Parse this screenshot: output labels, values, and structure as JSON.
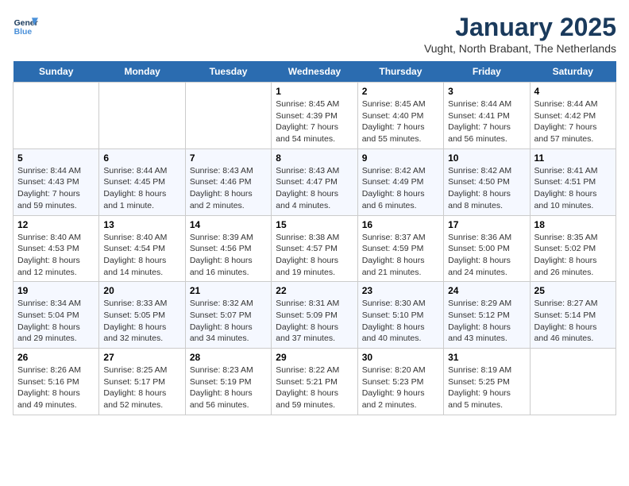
{
  "header": {
    "logo_line1": "General",
    "logo_line2": "Blue",
    "month_title": "January 2025",
    "subtitle": "Vught, North Brabant, The Netherlands"
  },
  "weekdays": [
    "Sunday",
    "Monday",
    "Tuesday",
    "Wednesday",
    "Thursday",
    "Friday",
    "Saturday"
  ],
  "weeks": [
    [
      {
        "day": "",
        "info": ""
      },
      {
        "day": "",
        "info": ""
      },
      {
        "day": "",
        "info": ""
      },
      {
        "day": "1",
        "info": "Sunrise: 8:45 AM\nSunset: 4:39 PM\nDaylight: 7 hours\nand 54 minutes."
      },
      {
        "day": "2",
        "info": "Sunrise: 8:45 AM\nSunset: 4:40 PM\nDaylight: 7 hours\nand 55 minutes."
      },
      {
        "day": "3",
        "info": "Sunrise: 8:44 AM\nSunset: 4:41 PM\nDaylight: 7 hours\nand 56 minutes."
      },
      {
        "day": "4",
        "info": "Sunrise: 8:44 AM\nSunset: 4:42 PM\nDaylight: 7 hours\nand 57 minutes."
      }
    ],
    [
      {
        "day": "5",
        "info": "Sunrise: 8:44 AM\nSunset: 4:43 PM\nDaylight: 7 hours\nand 59 minutes."
      },
      {
        "day": "6",
        "info": "Sunrise: 8:44 AM\nSunset: 4:45 PM\nDaylight: 8 hours\nand 1 minute."
      },
      {
        "day": "7",
        "info": "Sunrise: 8:43 AM\nSunset: 4:46 PM\nDaylight: 8 hours\nand 2 minutes."
      },
      {
        "day": "8",
        "info": "Sunrise: 8:43 AM\nSunset: 4:47 PM\nDaylight: 8 hours\nand 4 minutes."
      },
      {
        "day": "9",
        "info": "Sunrise: 8:42 AM\nSunset: 4:49 PM\nDaylight: 8 hours\nand 6 minutes."
      },
      {
        "day": "10",
        "info": "Sunrise: 8:42 AM\nSunset: 4:50 PM\nDaylight: 8 hours\nand 8 minutes."
      },
      {
        "day": "11",
        "info": "Sunrise: 8:41 AM\nSunset: 4:51 PM\nDaylight: 8 hours\nand 10 minutes."
      }
    ],
    [
      {
        "day": "12",
        "info": "Sunrise: 8:40 AM\nSunset: 4:53 PM\nDaylight: 8 hours\nand 12 minutes."
      },
      {
        "day": "13",
        "info": "Sunrise: 8:40 AM\nSunset: 4:54 PM\nDaylight: 8 hours\nand 14 minutes."
      },
      {
        "day": "14",
        "info": "Sunrise: 8:39 AM\nSunset: 4:56 PM\nDaylight: 8 hours\nand 16 minutes."
      },
      {
        "day": "15",
        "info": "Sunrise: 8:38 AM\nSunset: 4:57 PM\nDaylight: 8 hours\nand 19 minutes."
      },
      {
        "day": "16",
        "info": "Sunrise: 8:37 AM\nSunset: 4:59 PM\nDaylight: 8 hours\nand 21 minutes."
      },
      {
        "day": "17",
        "info": "Sunrise: 8:36 AM\nSunset: 5:00 PM\nDaylight: 8 hours\nand 24 minutes."
      },
      {
        "day": "18",
        "info": "Sunrise: 8:35 AM\nSunset: 5:02 PM\nDaylight: 8 hours\nand 26 minutes."
      }
    ],
    [
      {
        "day": "19",
        "info": "Sunrise: 8:34 AM\nSunset: 5:04 PM\nDaylight: 8 hours\nand 29 minutes."
      },
      {
        "day": "20",
        "info": "Sunrise: 8:33 AM\nSunset: 5:05 PM\nDaylight: 8 hours\nand 32 minutes."
      },
      {
        "day": "21",
        "info": "Sunrise: 8:32 AM\nSunset: 5:07 PM\nDaylight: 8 hours\nand 34 minutes."
      },
      {
        "day": "22",
        "info": "Sunrise: 8:31 AM\nSunset: 5:09 PM\nDaylight: 8 hours\nand 37 minutes."
      },
      {
        "day": "23",
        "info": "Sunrise: 8:30 AM\nSunset: 5:10 PM\nDaylight: 8 hours\nand 40 minutes."
      },
      {
        "day": "24",
        "info": "Sunrise: 8:29 AM\nSunset: 5:12 PM\nDaylight: 8 hours\nand 43 minutes."
      },
      {
        "day": "25",
        "info": "Sunrise: 8:27 AM\nSunset: 5:14 PM\nDaylight: 8 hours\nand 46 minutes."
      }
    ],
    [
      {
        "day": "26",
        "info": "Sunrise: 8:26 AM\nSunset: 5:16 PM\nDaylight: 8 hours\nand 49 minutes."
      },
      {
        "day": "27",
        "info": "Sunrise: 8:25 AM\nSunset: 5:17 PM\nDaylight: 8 hours\nand 52 minutes."
      },
      {
        "day": "28",
        "info": "Sunrise: 8:23 AM\nSunset: 5:19 PM\nDaylight: 8 hours\nand 56 minutes."
      },
      {
        "day": "29",
        "info": "Sunrise: 8:22 AM\nSunset: 5:21 PM\nDaylight: 8 hours\nand 59 minutes."
      },
      {
        "day": "30",
        "info": "Sunrise: 8:20 AM\nSunset: 5:23 PM\nDaylight: 9 hours\nand 2 minutes."
      },
      {
        "day": "31",
        "info": "Sunrise: 8:19 AM\nSunset: 5:25 PM\nDaylight: 9 hours\nand 5 minutes."
      },
      {
        "day": "",
        "info": ""
      }
    ]
  ]
}
